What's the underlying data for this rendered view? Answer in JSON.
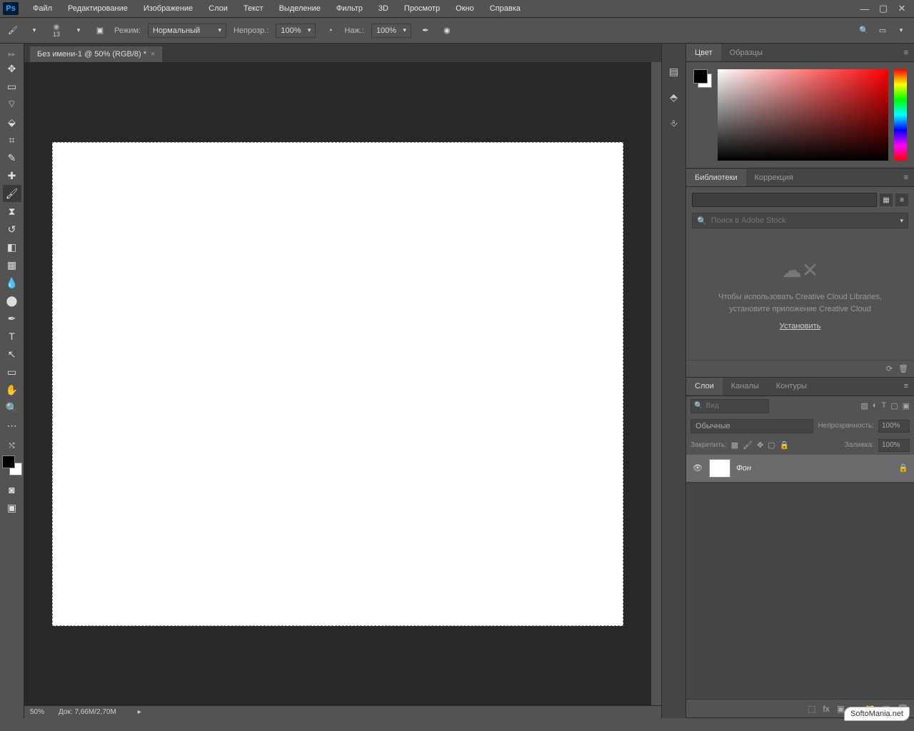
{
  "app": {
    "logo": "Ps"
  },
  "menu": [
    "Файл",
    "Редактирование",
    "Изображение",
    "Слои",
    "Текст",
    "Выделение",
    "Фильтр",
    "3D",
    "Просмотр",
    "Окно",
    "Справка"
  ],
  "options": {
    "brush_size": "13",
    "mode_label": "Режим:",
    "mode_value": "Нормальный",
    "opacity_label": "Непрозр.:",
    "opacity_value": "100%",
    "flow_label": "Наж.:",
    "flow_value": "100%"
  },
  "document": {
    "tab_title": "Без имени-1 @ 50% (RGB/8) *",
    "zoom": "50%",
    "doc_size_label": "Док:",
    "doc_size": "7,66M/2,70M"
  },
  "panels": {
    "color": {
      "tab1": "Цвет",
      "tab2": "Образцы"
    },
    "libraries": {
      "tab1": "Библиотеки",
      "tab2": "Коррекция",
      "search_placeholder": "Поиск в Adobe Stock",
      "empty_line1": "Чтобы использовать Creative Cloud Libraries,",
      "empty_line2": "установите приложение Creative Cloud",
      "install_link": "Установить"
    },
    "layers": {
      "tab1": "Слои",
      "tab2": "Каналы",
      "tab3": "Контуры",
      "search_placeholder": "Вид",
      "blend_mode": "Обычные",
      "opacity_label": "Непрозрачность:",
      "opacity_value": "100%",
      "lock_label": "Закрепить:",
      "fill_label": "Заливка:",
      "fill_value": "100%",
      "layer_name": "Фон"
    }
  },
  "watermark": "SoftoMania.net"
}
